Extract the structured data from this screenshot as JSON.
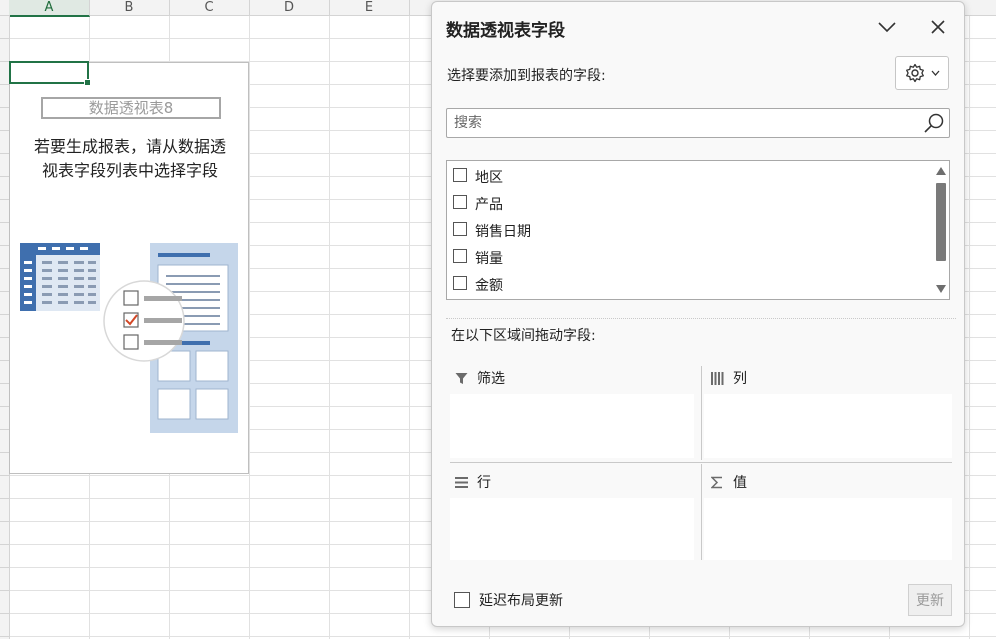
{
  "sheet": {
    "columns": [
      "A",
      "B",
      "C",
      "D",
      "E"
    ]
  },
  "pivot_placeholder": {
    "name": "数据透视表8",
    "hint_line1": "若要生成报表，请从数据透",
    "hint_line2": "视表字段列表中选择字段"
  },
  "pane": {
    "title": "数据透视表字段",
    "choose_label": "选择要添加到报表的字段:",
    "search_placeholder": "搜索",
    "fields": [
      {
        "label": "地区",
        "checked": false
      },
      {
        "label": "产品",
        "checked": false
      },
      {
        "label": "销售日期",
        "checked": false
      },
      {
        "label": "销量",
        "checked": false
      },
      {
        "label": "金额",
        "checked": false
      }
    ],
    "drag_label": "在以下区域间拖动字段:",
    "areas": {
      "filters": "筛选",
      "columns": "列",
      "rows": "行",
      "values": "值"
    },
    "defer_label": "延迟布局更新",
    "update_label": "更新"
  },
  "colors": {
    "excel_green": "#217346",
    "illus_blue": "#3f6fae",
    "illus_light_blue": "#c5d6ea"
  }
}
